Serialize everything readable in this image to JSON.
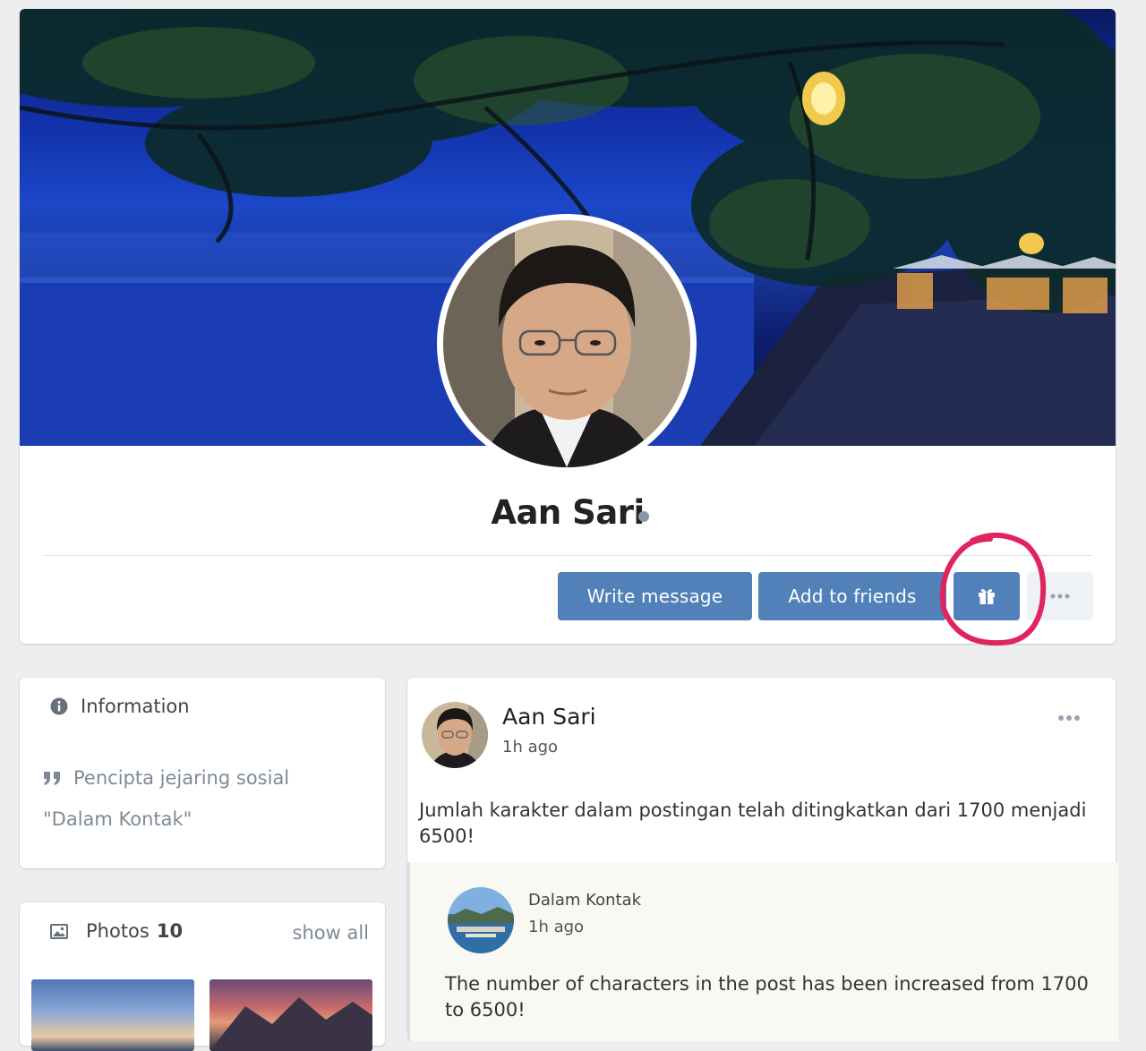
{
  "profile": {
    "name": "Aan Sari",
    "buttons": {
      "write_message": "Write message",
      "add_to_friends": "Add to friends"
    },
    "icons": {
      "gift": "gift-icon",
      "more": "more-dots-icon",
      "online": "online-status-dot"
    },
    "colors": {
      "button": "#5181b8",
      "highlight_circle": "#e0245e"
    }
  },
  "info": {
    "title": "Information",
    "quote_line1": "Pencipta jejaring sosial",
    "quote_line2": "\"Dalam Kontak\""
  },
  "photos": {
    "label": "Photos",
    "count": "10",
    "show_all": "show all"
  },
  "post": {
    "author": "Aan Sari",
    "time": "1h ago",
    "text": "Jumlah karakter dalam postingan telah ditingkatkan dari 1700 menjadi 6500!",
    "repost": {
      "author": "Dalam Kontak",
      "time": "1h ago",
      "text": "The number of characters in the post has been increased from 1700 to 6500!"
    }
  }
}
